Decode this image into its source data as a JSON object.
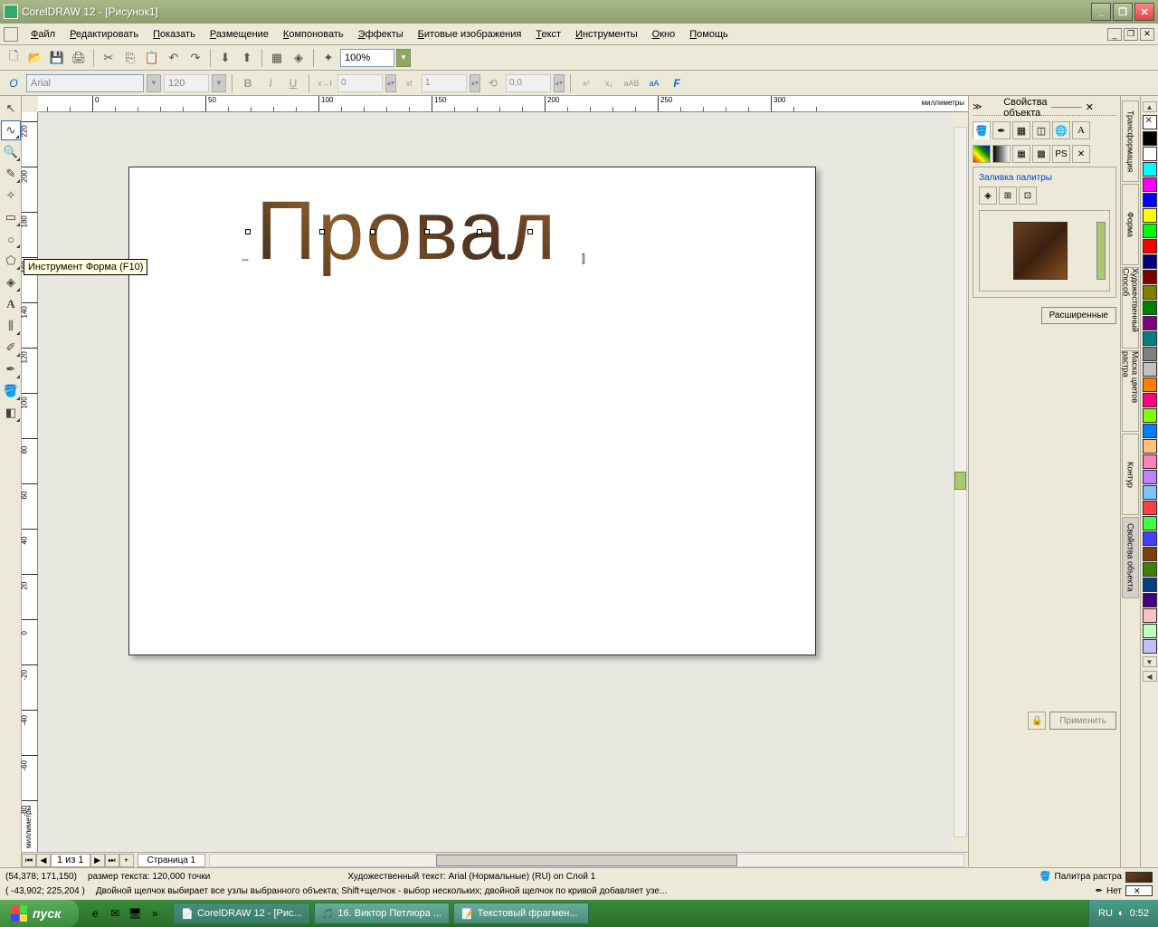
{
  "titlebar": {
    "title": "CorelDRAW 12 - [Рисунок1]"
  },
  "menubar": {
    "file": "Файл",
    "edit": "Редактировать",
    "view": "Показать",
    "layout": "Размещение",
    "arrange": "Компоновать",
    "effects": "Эффекты",
    "bitmaps": "Битовые изображения",
    "text": "Текст",
    "tools": "Инструменты",
    "window": "Окно",
    "help": "Помощь"
  },
  "toolbar": {
    "zoom": "100%"
  },
  "property_bar": {
    "font": "Arial",
    "size": "120",
    "kerning": "0",
    "xoffset": "1",
    "angle": "0,0"
  },
  "ruler_unit": "миллиметры",
  "tooltip": "Инструмент Форма (F10)",
  "canvas_text": "Провал",
  "page_nav": {
    "counter": "1 из 1",
    "tab": "Страница 1"
  },
  "docker": {
    "title": "Свойства объекта",
    "fill_palette": "Заливка палитры",
    "advanced": "Расширенные",
    "apply": "Применить"
  },
  "side_tabs": {
    "transform": "Трансформация",
    "shape": "Форма",
    "artistic": "Художественный Способ",
    "mask": "Маска цветов растра",
    "outline": "Контур",
    "props": "Свойства объекта"
  },
  "status": {
    "line1_coords": "(54,378; 171,150)",
    "line1_size": "размер текста: 120,000 точки",
    "line1_desc": "Художественный текст: Arial (Нормальные) (RU) on Слой 1",
    "line2_coords": "( -43,902; 225,204 )",
    "line2_hint": "Двойной щелчок выбирает все узлы выбранного объекта; Shift+щелчок - выбор нескольких; двойной щелчок по кривой добавляет узе...",
    "fill_label": "Палитра растра",
    "outline_label": "Нет"
  },
  "taskbar": {
    "start": "пуск",
    "task1": "CorelDRAW 12 - [Рис...",
    "task2": "16. Виктор Петлюра ...",
    "task3": "Текстовый фрагмен...",
    "lang": "RU",
    "time": "0:52"
  },
  "colors": [
    "#000000",
    "#ffffff",
    "#00ffff",
    "#ff00ff",
    "#0000ff",
    "#ffff00",
    "#00ff00",
    "#ff0000",
    "#000080",
    "#800000",
    "#808000",
    "#008000",
    "#800080",
    "#008080",
    "#808080",
    "#c0c0c0",
    "#ff8000",
    "#ff0080",
    "#80ff00",
    "#0080ff",
    "#ffc080",
    "#ff80c0",
    "#c080ff",
    "#80c0ff",
    "#ff4040",
    "#40ff40",
    "#4040ff",
    "#804000",
    "#408000",
    "#004080",
    "#400080",
    "#ffc0c0",
    "#c0ffc0",
    "#c0c0ff"
  ]
}
